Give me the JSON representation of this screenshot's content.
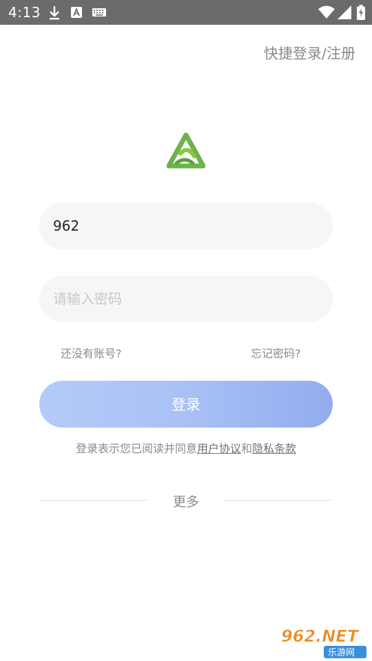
{
  "status_bar": {
    "time": "4:13",
    "icons": [
      "download-icon",
      "a-icon",
      "keyboard-icon",
      "wifi-icon",
      "signal-icon",
      "battery-icon"
    ]
  },
  "header": {
    "quick_login_register": "快捷登录/注册"
  },
  "form": {
    "account_value": "962",
    "password_placeholder": "请输入密码",
    "no_account_link": "还没有账号?",
    "forgot_password_link": "忘记密码?",
    "login_button": "登录"
  },
  "agreement": {
    "prefix": "登录表示您已阅读并同意",
    "user_agreement": "用户协议",
    "and": "和",
    "privacy_terms": "隐私条款"
  },
  "more": {
    "label": "更多"
  },
  "watermark": {
    "text": "962.NET",
    "subtext": "乐游网"
  },
  "colors": {
    "status_bar_bg": "#6b6b6b",
    "button_gradient_start": "#b4cbfa",
    "button_gradient_end": "#93acee",
    "logo_green": "#6bb34a",
    "watermark_orange": "#f08a24"
  }
}
